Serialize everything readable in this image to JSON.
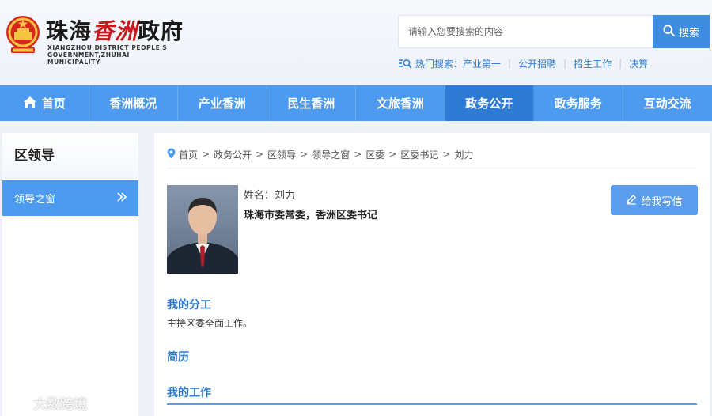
{
  "header": {
    "logo_part1": "珠海",
    "logo_part2": "香洲",
    "logo_part3": "政府",
    "logo_en_line1": "XIANGZHOU DISTRICT PEOPLE'S",
    "logo_en_line2": "GOVERNMENT,ZHUHAI MUNICIPALITY",
    "search_placeholder": "请输入您要搜索的内容",
    "search_button": "搜索",
    "hot_label": "热门搜索：",
    "hot_links": [
      "产业第一",
      "公开招聘",
      "招生工作",
      "决算"
    ]
  },
  "nav": {
    "items": [
      "首页",
      "香洲概况",
      "产业香洲",
      "民生香洲",
      "文旅香洲",
      "政务公开",
      "政务服务",
      "互动交流"
    ],
    "active_index": 5
  },
  "sidebar": {
    "title": "区领导",
    "item": "领导之窗"
  },
  "breadcrumb": [
    "首页",
    "政务公开",
    "区领导",
    "领导之窗",
    "区委",
    "区委书记",
    "刘力"
  ],
  "profile": {
    "name_line": "姓名：刘力",
    "title_line": "珠海市委常委，香洲区委书记",
    "write_button": "给我写信"
  },
  "sections": {
    "duty_heading": "我的分工",
    "duty_text": "主持区委全面工作。",
    "resume_heading": "简历",
    "work_heading": "我的工作"
  },
  "watermark": "大数跨境",
  "colors": {
    "nav_bg": "#4c9bf0",
    "nav_active": "#2e7bd6",
    "accent_text": "#2a7ad4",
    "logo_red": "#c8161d"
  }
}
